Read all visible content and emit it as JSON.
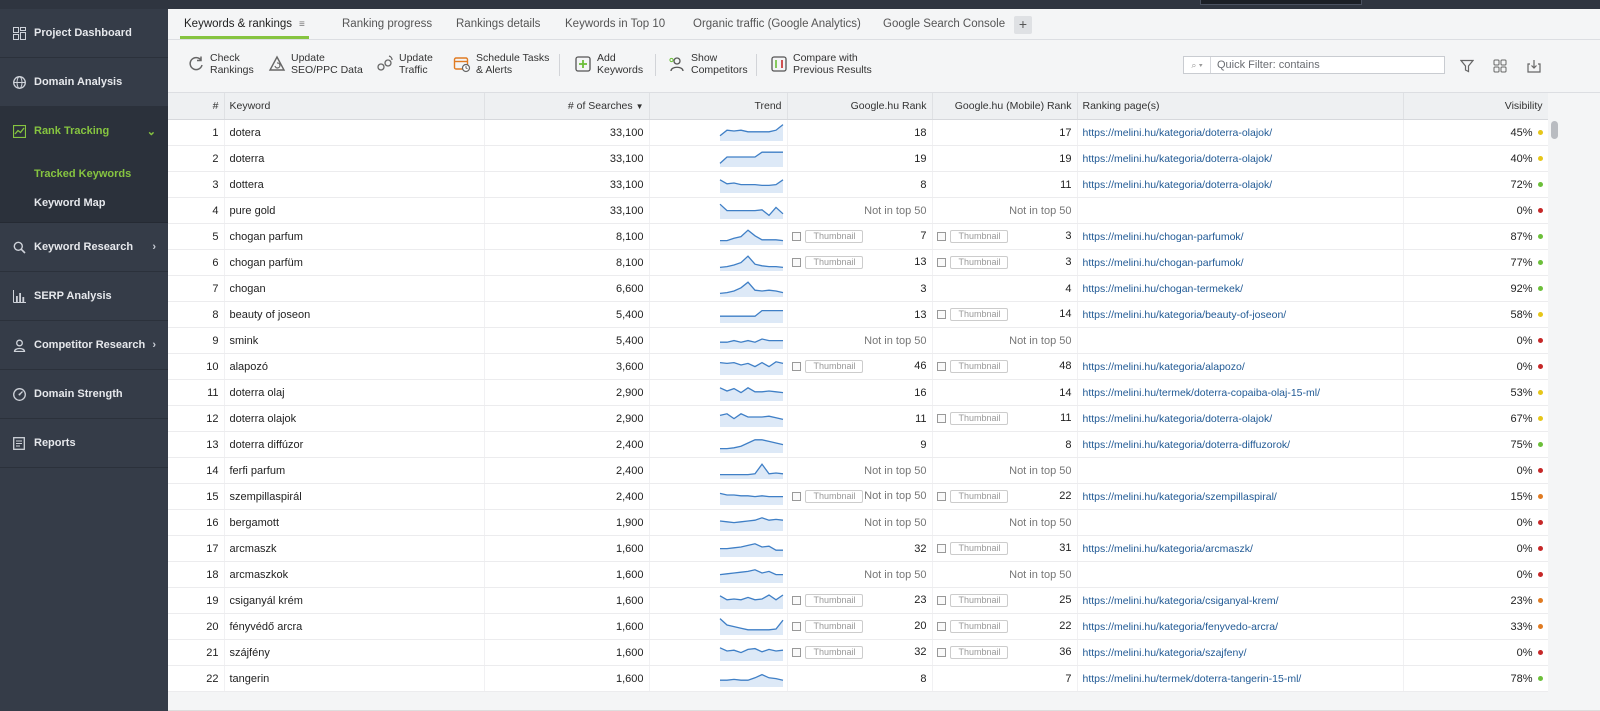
{
  "sidebar": {
    "items": [
      {
        "label": "Project Dashboard",
        "icon": "dashboard-grid-icon"
      },
      {
        "label": "Domain Analysis",
        "icon": "globe-icon"
      },
      {
        "label": "Rank Tracking",
        "icon": "chart-line-icon",
        "active": true
      },
      {
        "label": "Keyword Research",
        "icon": "search-icon"
      },
      {
        "label": "SERP Analysis",
        "icon": "bar-chart-icon"
      },
      {
        "label": "Competitor Research",
        "icon": "user-icon"
      },
      {
        "label": "Domain Strength",
        "icon": "gauge-icon"
      },
      {
        "label": "Reports",
        "icon": "document-icon"
      }
    ],
    "sub_items": [
      {
        "label": "Tracked Keywords",
        "active": true
      },
      {
        "label": "Keyword Map"
      }
    ],
    "accent": "#86c440",
    "background": "#353c48"
  },
  "tabs": [
    {
      "label": "Keywords & rankings",
      "active": true
    },
    {
      "label": "Ranking progress"
    },
    {
      "label": "Rankings details"
    },
    {
      "label": "Keywords in Top 10"
    },
    {
      "label": "Organic traffic (Google Analytics)"
    },
    {
      "label": "Google Search Console"
    }
  ],
  "toolbar": {
    "buttons": [
      {
        "label": "Check\nRankings",
        "icon": "refresh-rankings-icon"
      },
      {
        "label": "Update\nSEO/PPC Data",
        "icon": "triangle-update-icon"
      },
      {
        "label": "Update\nTraffic",
        "icon": "traffic-icon"
      },
      {
        "label": "Schedule Tasks\n& Alerts",
        "icon": "calendar-clock-icon"
      },
      {
        "label": "Add\nKeywords",
        "icon": "plus-square-icon"
      },
      {
        "label": "Show\nCompetitors",
        "icon": "competitors-icon"
      },
      {
        "label": "Compare with\nPrevious Results",
        "icon": "compare-icon"
      }
    ],
    "filter_placeholder": "Quick Filter: contains"
  },
  "table": {
    "columns": [
      "#",
      "Keyword",
      "# of Searches",
      "Trend",
      "Google.hu Rank",
      "Google.hu (Mobile) Rank",
      "Ranking page(s)",
      "Visibility"
    ],
    "thumbnail_label": "Thumbnail",
    "not_in_top": "Not in top 50",
    "dot_colors": {
      "green": "#6cbf3a",
      "yellow": "#e6c619",
      "orange": "#e07b22",
      "red": "#c62828"
    },
    "rows": [
      {
        "n": "1",
        "kw": "dotera",
        "searches": "33,100",
        "rank": "18",
        "rank_thumb": false,
        "mrank": "17",
        "mrank_thumb": false,
        "url": "https://melini.hu/kategoria/doterra-olajok/",
        "vis": "45%",
        "dot": "yellow",
        "trend": [
          0.8,
          0.45,
          0.5,
          0.45,
          0.55,
          0.55,
          0.55,
          0.55,
          0.45,
          0.1
        ]
      },
      {
        "n": "2",
        "kw": "doterra",
        "searches": "33,100",
        "rank": "19",
        "rank_thumb": false,
        "mrank": "19",
        "mrank_thumb": false,
        "url": "https://melini.hu/kategoria/doterra-olajok/",
        "vis": "40%",
        "dot": "yellow",
        "trend": [
          0.9,
          0.5,
          0.5,
          0.5,
          0.5,
          0.5,
          0.2,
          0.2,
          0.2,
          0.2
        ]
      },
      {
        "n": "3",
        "kw": "dottera",
        "searches": "33,100",
        "rank": "8",
        "rank_thumb": false,
        "mrank": "11",
        "mrank_thumb": false,
        "url": "https://melini.hu/kategoria/doterra-olajok/",
        "vis": "72%",
        "dot": "green",
        "trend": [
          0.3,
          0.55,
          0.5,
          0.6,
          0.6,
          0.6,
          0.65,
          0.65,
          0.6,
          0.3
        ]
      },
      {
        "n": "4",
        "kw": "pure gold",
        "searches": "33,100",
        "rank": "Not in top 50",
        "rank_thumb": false,
        "mrank": "Not in top 50",
        "mrank_thumb": false,
        "url": "",
        "vis": "0%",
        "dot": "red",
        "trend": [
          0.2,
          0.6,
          0.6,
          0.6,
          0.6,
          0.6,
          0.55,
          0.9,
          0.4,
          0.8
        ]
      },
      {
        "n": "5",
        "kw": "chogan parfum",
        "searches": "8,100",
        "rank": "7",
        "rank_thumb": true,
        "mrank": "3",
        "mrank_thumb": true,
        "url": "https://melini.hu/chogan-parfumok/",
        "vis": "87%",
        "dot": "green",
        "trend": [
          0.85,
          0.85,
          0.7,
          0.6,
          0.2,
          0.55,
          0.8,
          0.8,
          0.8,
          0.85
        ]
      },
      {
        "n": "6",
        "kw": "chogan parfüm",
        "searches": "8,100",
        "rank": "13",
        "rank_thumb": true,
        "mrank": "3",
        "mrank_thumb": true,
        "url": "https://melini.hu/chogan-parfumok/",
        "vis": "77%",
        "dot": "green",
        "trend": [
          0.9,
          0.85,
          0.75,
          0.6,
          0.2,
          0.7,
          0.8,
          0.85,
          0.85,
          0.9
        ]
      },
      {
        "n": "7",
        "kw": "chogan",
        "searches": "6,600",
        "rank": "3",
        "rank_thumb": false,
        "mrank": "4",
        "mrank_thumb": false,
        "url": "https://melini.hu/chogan-termekek/",
        "vis": "92%",
        "dot": "green",
        "trend": [
          0.9,
          0.85,
          0.75,
          0.55,
          0.2,
          0.7,
          0.75,
          0.7,
          0.75,
          0.85
        ]
      },
      {
        "n": "8",
        "kw": "beauty of joseon",
        "searches": "5,400",
        "rank": "13",
        "rank_thumb": false,
        "mrank": "14",
        "mrank_thumb": true,
        "url": "https://melini.hu/kategoria/beauty-of-joseon/",
        "vis": "58%",
        "dot": "yellow",
        "trend": [
          0.7,
          0.7,
          0.7,
          0.7,
          0.7,
          0.7,
          0.35,
          0.35,
          0.35,
          0.35
        ]
      },
      {
        "n": "9",
        "kw": "smink",
        "searches": "5,400",
        "rank": "Not in top 50",
        "rank_thumb": false,
        "mrank": "Not in top 50",
        "mrank_thumb": false,
        "url": "",
        "vis": "0%",
        "dot": "red",
        "trend": [
          0.7,
          0.7,
          0.6,
          0.7,
          0.6,
          0.7,
          0.5,
          0.6,
          0.6,
          0.6
        ]
      },
      {
        "n": "10",
        "kw": "alapozó",
        "searches": "3,600",
        "rank": "46",
        "rank_thumb": true,
        "mrank": "48",
        "mrank_thumb": true,
        "url": "https://melini.hu/kategoria/alapozo/",
        "vis": "0%",
        "dot": "red",
        "trend": [
          0.35,
          0.4,
          0.35,
          0.5,
          0.4,
          0.6,
          0.35,
          0.6,
          0.3,
          0.4
        ]
      },
      {
        "n": "11",
        "kw": "doterra olaj",
        "searches": "2,900",
        "rank": "16",
        "rank_thumb": false,
        "mrank": "14",
        "mrank_thumb": false,
        "url": "https://melini.hu/termek/doterra-copaiba-olaj-15-ml/",
        "vis": "53%",
        "dot": "yellow",
        "trend": [
          0.3,
          0.5,
          0.35,
          0.6,
          0.3,
          0.55,
          0.55,
          0.5,
          0.55,
          0.6
        ]
      },
      {
        "n": "12",
        "kw": "doterra olajok",
        "searches": "2,900",
        "rank": "11",
        "rank_thumb": false,
        "mrank": "11",
        "mrank_thumb": true,
        "url": "https://melini.hu/kategoria/doterra-olajok/",
        "vis": "67%",
        "dot": "yellow",
        "trend": [
          0.4,
          0.3,
          0.6,
          0.3,
          0.5,
          0.5,
          0.5,
          0.45,
          0.55,
          0.65
        ]
      },
      {
        "n": "13",
        "kw": "doterra diffúzor",
        "searches": "2,400",
        "rank": "9",
        "rank_thumb": false,
        "mrank": "8",
        "mrank_thumb": false,
        "url": "https://melini.hu/kategoria/doterra-diffuzorok/",
        "vis": "75%",
        "dot": "green",
        "trend": [
          0.85,
          0.85,
          0.8,
          0.7,
          0.5,
          0.3,
          0.3,
          0.4,
          0.5,
          0.6
        ]
      },
      {
        "n": "14",
        "kw": "ferfi parfum",
        "searches": "2,400",
        "rank": "Not in top 50",
        "rank_thumb": false,
        "mrank": "Not in top 50",
        "mrank_thumb": false,
        "url": "",
        "vis": "0%",
        "dot": "red",
        "trend": [
          0.85,
          0.85,
          0.85,
          0.85,
          0.85,
          0.8,
          0.2,
          0.8,
          0.75,
          0.8
        ]
      },
      {
        "n": "15",
        "kw": "szempillaspirál",
        "searches": "2,400",
        "rank": "Not in top 50",
        "rank_thumb": true,
        "mrank": "22",
        "mrank_thumb": true,
        "url": "https://melini.hu/kategoria/szempillaspiral/",
        "vis": "15%",
        "dot": "orange",
        "trend": [
          0.4,
          0.5,
          0.5,
          0.55,
          0.55,
          0.6,
          0.55,
          0.6,
          0.6,
          0.6
        ]
      },
      {
        "n": "16",
        "kw": "bergamott",
        "searches": "1,900",
        "rank": "Not in top 50",
        "rank_thumb": false,
        "mrank": "Not in top 50",
        "mrank_thumb": false,
        "url": "",
        "vis": "0%",
        "dot": "red",
        "trend": [
          0.5,
          0.55,
          0.6,
          0.55,
          0.5,
          0.45,
          0.3,
          0.45,
          0.4,
          0.45
        ]
      },
      {
        "n": "17",
        "kw": "arcmaszk",
        "searches": "1,600",
        "rank": "32",
        "rank_thumb": false,
        "mrank": "31",
        "mrank_thumb": true,
        "url": "https://melini.hu/kategoria/arcmaszk/",
        "vis": "0%",
        "dot": "red",
        "trend": [
          0.6,
          0.6,
          0.55,
          0.5,
          0.4,
          0.3,
          0.5,
          0.45,
          0.7,
          0.7
        ]
      },
      {
        "n": "18",
        "kw": "arcmaszkok",
        "searches": "1,600",
        "rank": "Not in top 50",
        "rank_thumb": false,
        "mrank": "Not in top 50",
        "mrank_thumb": false,
        "url": "",
        "vis": "0%",
        "dot": "red",
        "trend": [
          0.6,
          0.55,
          0.5,
          0.45,
          0.4,
          0.3,
          0.5,
          0.4,
          0.6,
          0.6
        ]
      },
      {
        "n": "19",
        "kw": "csiganyál krém",
        "searches": "1,600",
        "rank": "23",
        "rank_thumb": true,
        "mrank": "25",
        "mrank_thumb": true,
        "url": "https://melini.hu/kategoria/csiganyal-krem/",
        "vis": "23%",
        "dot": "orange",
        "trend": [
          0.3,
          0.55,
          0.5,
          0.55,
          0.4,
          0.55,
          0.5,
          0.25,
          0.55,
          0.25
        ]
      },
      {
        "n": "20",
        "kw": "fényvédő arcra",
        "searches": "1,600",
        "rank": "20",
        "rank_thumb": true,
        "mrank": "22",
        "mrank_thumb": true,
        "url": "https://melini.hu/kategoria/fenyvedo-arcra/",
        "vis": "33%",
        "dot": "orange",
        "trend": [
          0.1,
          0.5,
          0.6,
          0.7,
          0.8,
          0.8,
          0.8,
          0.8,
          0.75,
          0.2
        ]
      },
      {
        "n": "21",
        "kw": "szájfény",
        "searches": "1,600",
        "rank": "32",
        "rank_thumb": true,
        "mrank": "36",
        "mrank_thumb": true,
        "url": "https://melini.hu/kategoria/szajfeny/",
        "vis": "0%",
        "dot": "red",
        "trend": [
          0.3,
          0.5,
          0.45,
          0.6,
          0.4,
          0.35,
          0.55,
          0.4,
          0.5,
          0.45
        ]
      },
      {
        "n": "22",
        "kw": "tangerin",
        "searches": "1,600",
        "rank": "8",
        "rank_thumb": false,
        "mrank": "7",
        "mrank_thumb": false,
        "url": "https://melini.hu/termek/doterra-tangerin-15-ml/",
        "vis": "78%",
        "dot": "green",
        "trend": [
          0.7,
          0.7,
          0.65,
          0.7,
          0.7,
          0.55,
          0.35,
          0.55,
          0.6,
          0.7
        ]
      }
    ]
  }
}
